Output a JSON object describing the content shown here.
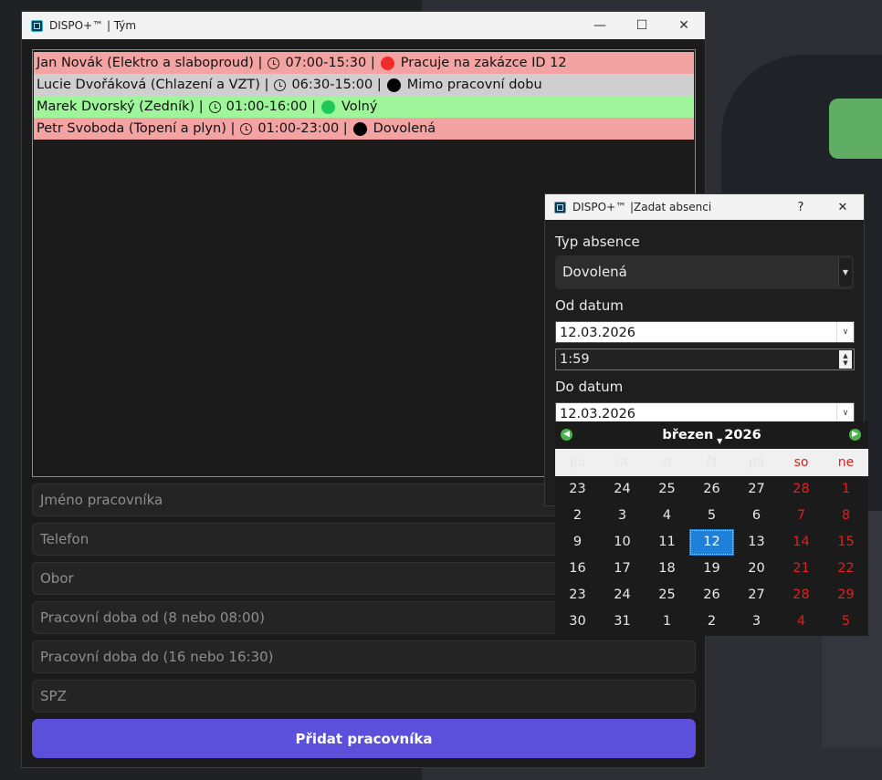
{
  "main_window": {
    "title": "DISPO+™ | Tým",
    "controls": {
      "minimize": "—",
      "maximize": "☐",
      "close": "✕"
    },
    "workers": [
      {
        "name": "Jan Novák (Elektro a slaboproud) |",
        "hours": "07:00-15:30 |",
        "status": "Pracuje na zakázce ID 12",
        "row_color": "#f4a3a3",
        "status_color": "#f12b2b"
      },
      {
        "name": "Lucie Dvořáková (Chlazení a VZT) |",
        "hours": "06:30-15:00 |",
        "status": "Mimo pracovní dobu",
        "row_color": "#cfcfcf",
        "status_color": "#000000"
      },
      {
        "name": "Marek Dvorský (Zedník) |",
        "hours": "01:00-16:00 |",
        "status": "Volný",
        "row_color": "#9ef59a",
        "status_color": "#1ec85a"
      },
      {
        "name": "Petr Svoboda (Topení a plyn) |",
        "hours": "01:00-23:00 |",
        "status": "Dovolená",
        "row_color": "#f4a3a3",
        "status_color": "#000000"
      }
    ],
    "fields": {
      "name_placeholder": "Jméno pracovníka",
      "phone_placeholder": "Telefon",
      "field_placeholder": "Obor",
      "from_placeholder": "Pracovní doba od (8 nebo 08:00)",
      "to_placeholder": "Pracovní doba do (16 nebo 16:30)",
      "spz_placeholder": "SPZ"
    },
    "add_button": "Přidat pracovníka"
  },
  "dialog": {
    "title": "DISPO+™ |Zadat absenci",
    "help": "?",
    "close": "✕",
    "type_label": "Typ absence",
    "type_value": "Dovolená",
    "from_label": "Od datum",
    "from_value": "12.03.2026",
    "time_value": "1:59",
    "to_label": "Do datum",
    "to_value": "12.03.2026"
  },
  "calendar": {
    "month": "březen",
    "year": "2026",
    "weekdays": [
      "po",
      "út",
      "st",
      "čt",
      "pá",
      "so",
      "ne"
    ],
    "weeks": [
      [
        "23",
        "24",
        "25",
        "26",
        "27",
        "28",
        "1"
      ],
      [
        "2",
        "3",
        "4",
        "5",
        "6",
        "7",
        "8"
      ],
      [
        "9",
        "10",
        "11",
        "12",
        "13",
        "14",
        "15"
      ],
      [
        "16",
        "17",
        "18",
        "19",
        "20",
        "21",
        "22"
      ],
      [
        "23",
        "24",
        "25",
        "26",
        "27",
        "28",
        "29"
      ],
      [
        "30",
        "31",
        "1",
        "2",
        "3",
        "4",
        "5"
      ]
    ],
    "selected": "12",
    "weekend_color": "#e02020",
    "selected_color": "#1e80d8"
  },
  "theme": {
    "accent": "#5b4fdc"
  }
}
